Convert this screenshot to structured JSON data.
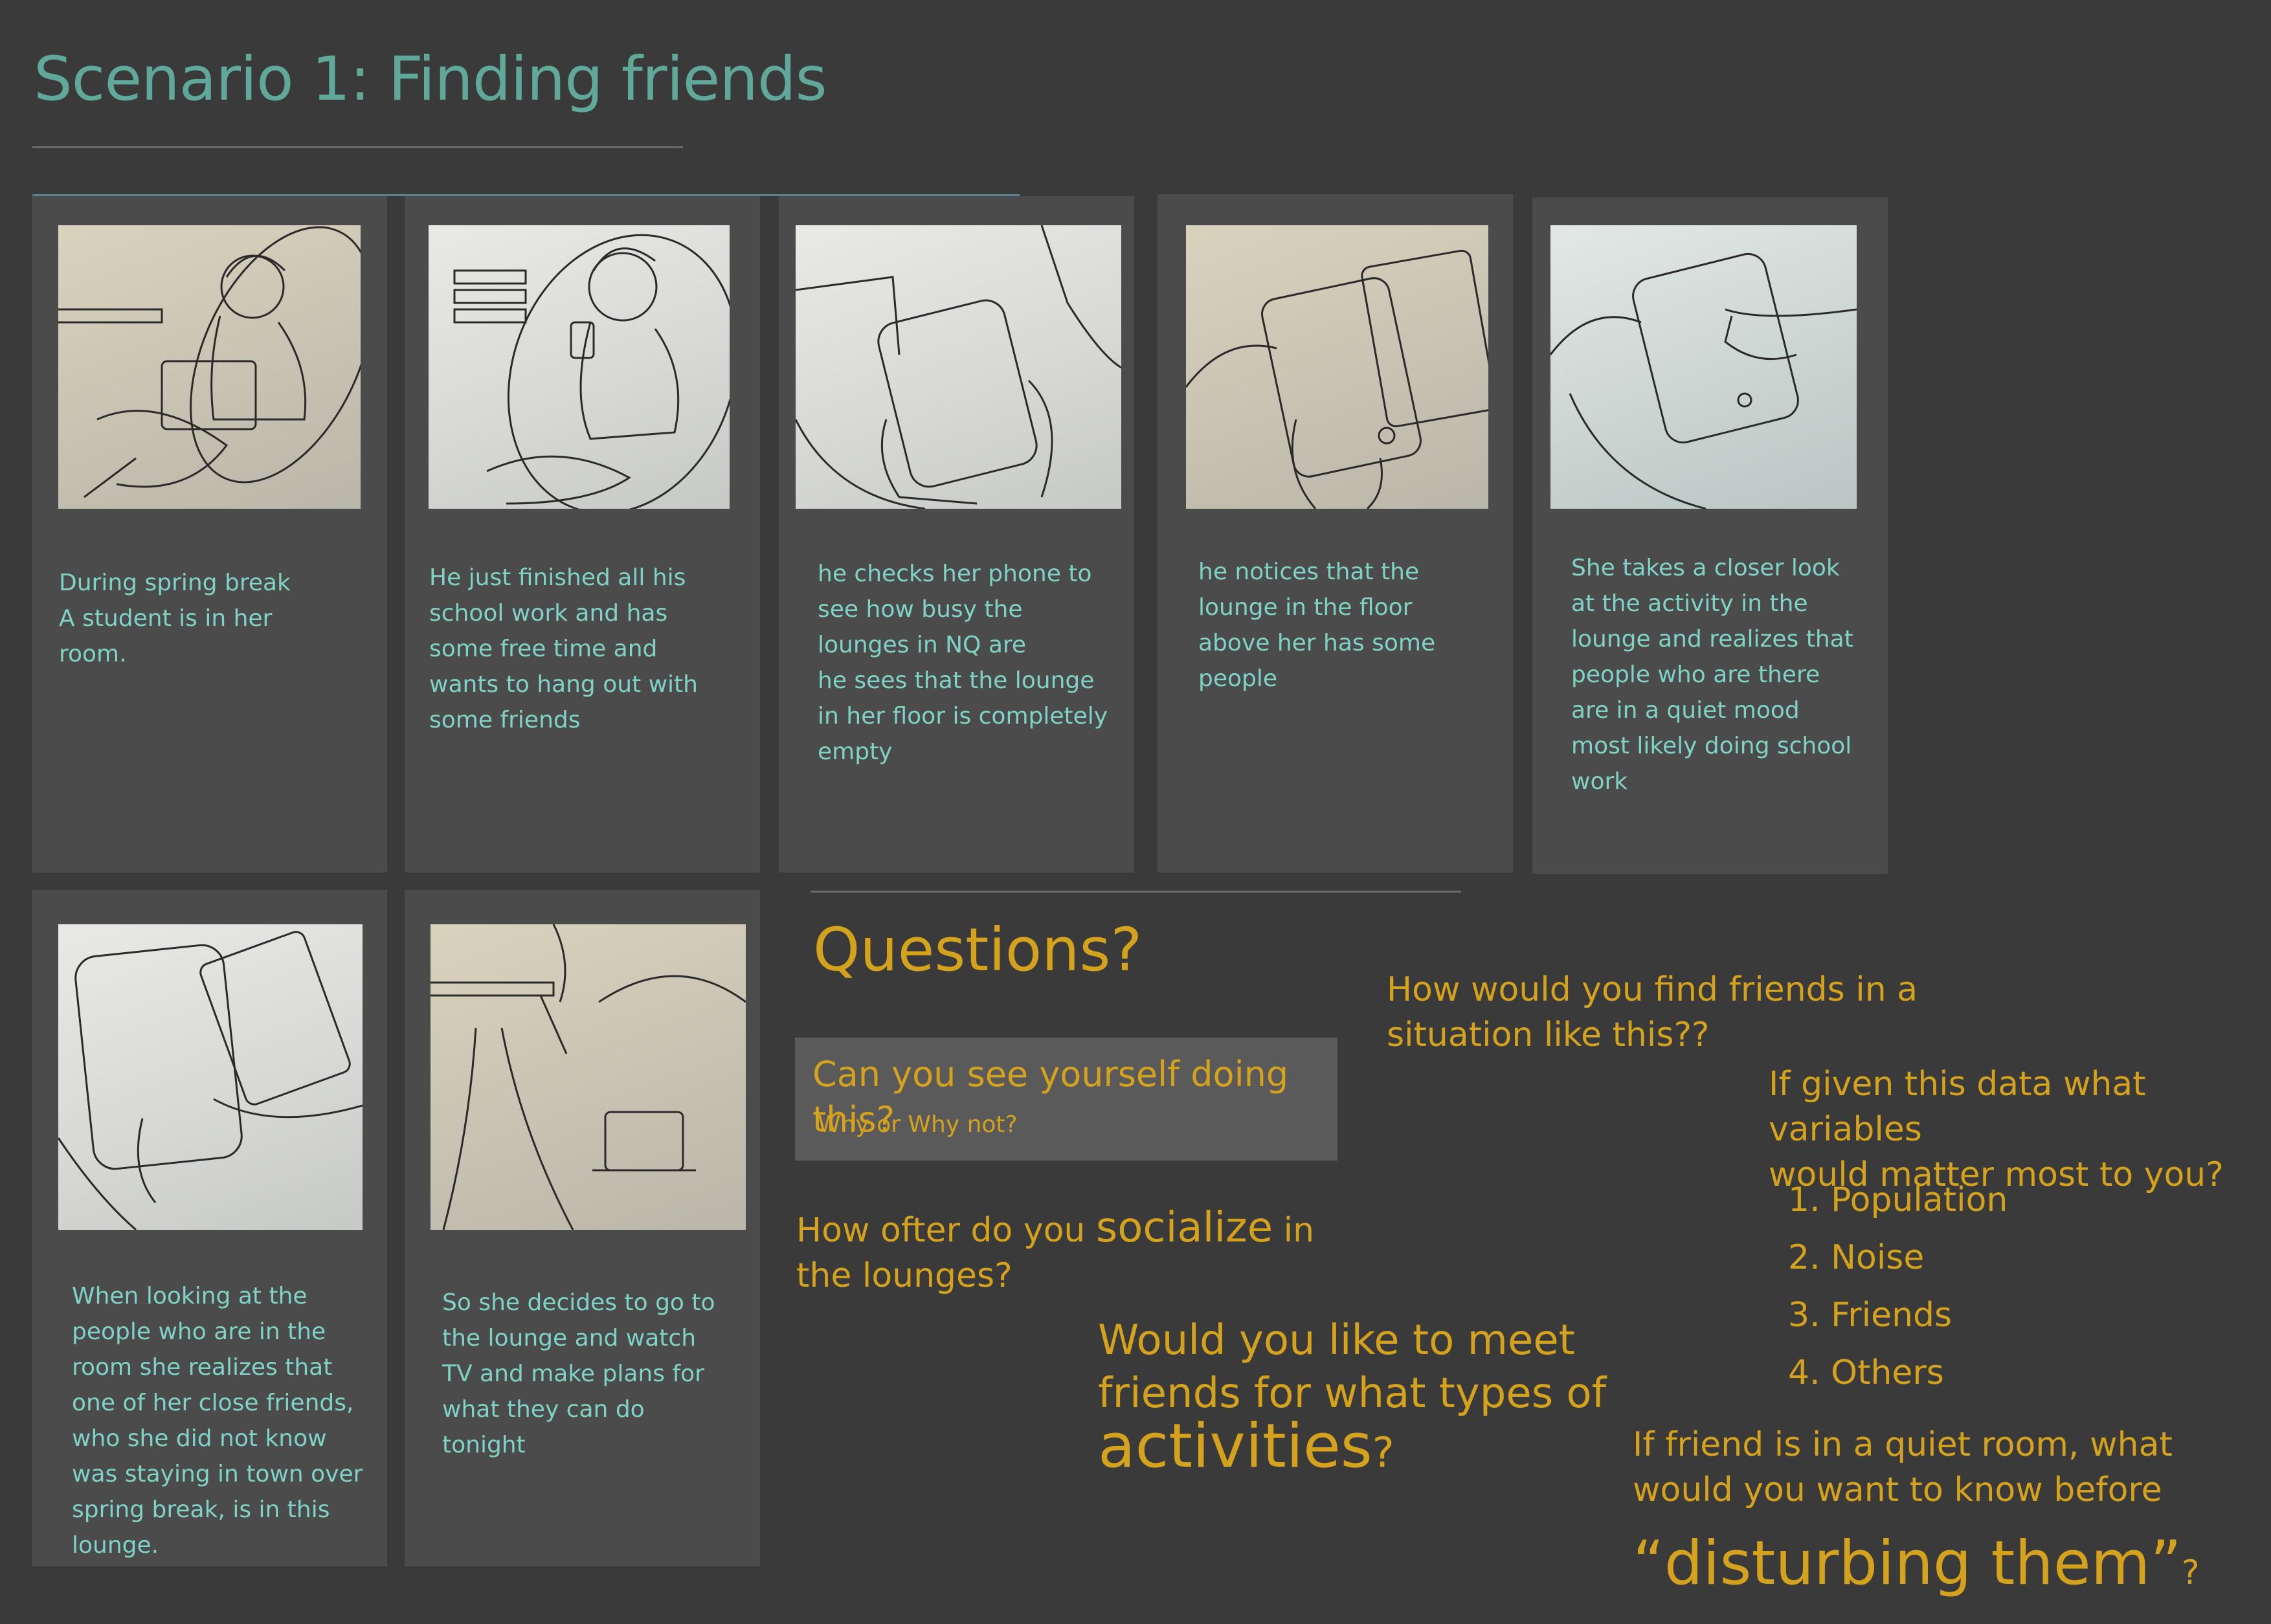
{
  "title": "Scenario 1: Finding friends",
  "panels": [
    {
      "caption": "During spring break\nA student is in her\nroom.",
      "sketch": "student-relaxing-sketch"
    },
    {
      "caption": "He just finished all his\nschool work and has\nsome free time and\nwants to hang out with\nsome friends",
      "sketch": "student-with-phone-sketch"
    },
    {
      "caption": "he checks her phone to\nsee how busy the\nlounges in NQ are\nhe sees that the lounge\nin her floor is completely\nempty",
      "sketch": "phone-in-hand-sketch"
    },
    {
      "caption": "he notices that the\nlounge in the floor\nabove her has some\npeople",
      "sketch": "phone-closeup-sketch"
    },
    {
      "caption": "She takes a closer look\nat the activity in the\nlounge and realizes that\npeople who are there\nare in a quiet mood\nmost likely doing school\nwork",
      "sketch": "phone-tap-sketch"
    },
    {
      "caption": "When looking at the\npeople who are in the\nroom she realizes that\none of her close friends,\nwho she did not know\nwas staying in town over\nspring break, is in this\nlounge.",
      "sketch": "phone-two-hands-sketch"
    },
    {
      "caption": "So she decides to go to\nthe lounge and watch\nTV and make plans for\nwhat they can do\ntonight",
      "sketch": "walking-to-lounge-sketch"
    }
  ],
  "questions": {
    "heading": "Questions?",
    "q1": "Can you see yourself doing this?",
    "q1_sub": "Why or Why not?",
    "q2_pre": "How ofter do you ",
    "q2_em": "socialize",
    "q2_post": " in\nthe lounges?",
    "q3_pre": "Would you like to meet\nfriends for what types of\n",
    "q3_em": "activities",
    "q3_post": "?",
    "q4": "How would you find friends in a\nsituation like this??",
    "q5": "If given this data what variables\nwould matter most to you?",
    "q5_options": [
      "1. Population",
      "2. Noise",
      "3. Friends",
      "4. Others"
    ],
    "q6_pre": "If  friend is in a quiet room, what\nwould you want to know before",
    "q6_em": "“disturbing them”",
    "q6_post": "?"
  },
  "colors": {
    "background": "#3a3a3a",
    "card": "#4b4b4b",
    "title": "#5fa89a",
    "caption": "#7fd3c4",
    "question": "#d4a21c"
  }
}
